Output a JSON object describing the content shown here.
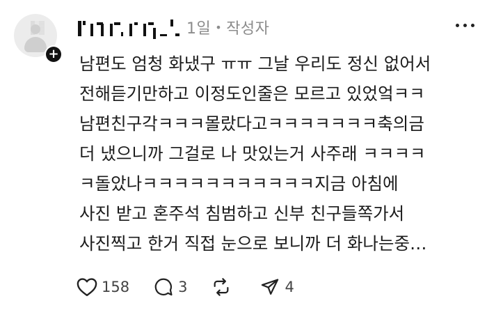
{
  "post": {
    "author_masked": "",
    "time": "1일",
    "separator": "•",
    "author_badge": "작성자",
    "lines": [
      "남편도 엄청 화냈구 ㅠㅠ 그날 우리도 정신 없어서",
      "전해듣기만하고 이정도인줄은 모르고 있었엌ㅋㅋ",
      "남편친구각ㅋㅋㅋ몰랐다고ㅋㅋㅋㅋㅋㅋㅋ축의금",
      "더 냈으니까 그걸로 나 맛있는거 사주래 ㅋㅋㅋㅋ",
      "ㅋ돌았나ㅋㅋㅋㅋㅋㅋㅋㅋㅋㅋㅋ지금 아침에",
      "사진 받고 혼주석 침범하고 신부 친구들쪽가서",
      "사진찍고 한거 직접 눈으로 보니까 더 화나는중…"
    ]
  },
  "actions": {
    "like_count": "158",
    "comment_count": "3",
    "share_count": "4"
  },
  "icons": {
    "avatar": "default-avatar-icon",
    "follow": "plus-icon",
    "more": "more-horizontal-icon",
    "like": "heart-icon",
    "comment": "comment-bubble-icon",
    "repost": "repost-icon",
    "share": "send-icon"
  }
}
